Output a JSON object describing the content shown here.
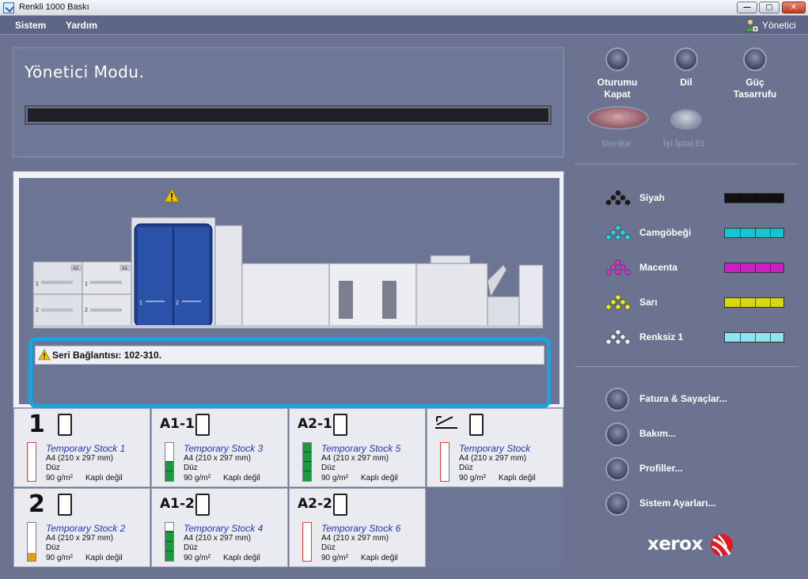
{
  "window": {
    "title": "Renkli 1000 Baskı",
    "min_glyph": "—",
    "max_glyph": "▢",
    "close_glyph": "✕"
  },
  "menu": {
    "items": [
      "Sistem",
      "Yardım"
    ],
    "user_label": "Yönetici"
  },
  "status": {
    "mode_title": "Yönetici Modu.",
    "progress": 0
  },
  "top_buttons": [
    {
      "label": "Oturumu\nKapat"
    },
    {
      "label": "Dil"
    },
    {
      "label": "Güç\nTasarrufu"
    }
  ],
  "job_buttons": {
    "stop_label": "Durdur",
    "cancel_label": "İşi İptal Et"
  },
  "machine": {
    "module_labels": [
      "A2",
      "A1"
    ],
    "tray_markers": [
      "1",
      "2",
      "1",
      "2",
      "1",
      "2"
    ]
  },
  "message": {
    "text": "Seri Bağlantısı: 102-310."
  },
  "trays": [
    {
      "id": "1",
      "name": "Temporary Stock 1",
      "size": "A4 (210 x 297 mm)",
      "type": "Düz",
      "weight": "90 g/m²",
      "coating": "Kaplı değil",
      "level": 0,
      "level_color": "#e34040"
    },
    {
      "id": "A1-1",
      "name": "Temporary Stock 3",
      "size": "A4 (210 x 297 mm)",
      "type": "Düz",
      "weight": "90 g/m²",
      "coating": "Kaplı değil",
      "level": 0.5,
      "level_color": "#1d9a3e"
    },
    {
      "id": "A2-1",
      "name": "Temporary Stock 5",
      "size": "A4 (210 x 297 mm)",
      "type": "Düz",
      "weight": "90 g/m²",
      "coating": "Kaplı değil",
      "level": 1.0,
      "level_color": "#1d9a3e"
    },
    {
      "id": "bypass",
      "name": "Temporary Stock",
      "size": "A4 (210 x 297 mm)",
      "type": "Düz",
      "weight": "90 g/m²",
      "coating": "Kaplı değil",
      "level": 0,
      "level_color": "#e34040"
    },
    {
      "id": "2",
      "name": "Temporary Stock 2",
      "size": "A4 (210 x 297 mm)",
      "type": "Düz",
      "weight": "90 g/m²",
      "coating": "Kaplı değil",
      "level": 0.2,
      "level_color": "#e0a010"
    },
    {
      "id": "A1-2",
      "name": "Temporary Stock 4",
      "size": "A4 (210 x 297 mm)",
      "type": "Düz",
      "weight": "90 g/m²",
      "coating": "Kaplı değil",
      "level": 0.8,
      "level_color": "#1d9a3e"
    },
    {
      "id": "A2-2",
      "name": "Temporary Stock 6",
      "size": "A4 (210 x 297 mm)",
      "type": "Düz",
      "weight": "90 g/m²",
      "coating": "Kaplı değil",
      "level": 0,
      "level_color": "#e34040"
    }
  ],
  "toners": [
    {
      "name": "Siyah",
      "color": "#111111",
      "dot_color": "#1a1a1a",
      "level": 1.0
    },
    {
      "name": "Camgöbeği",
      "color": "#18c4cf",
      "dot_color": "#22d6e6",
      "level": 1.0
    },
    {
      "name": "Macenta",
      "color": "#cc1fc4",
      "dot_color": "#e22ad8",
      "level": 1.0
    },
    {
      "name": "Sarı",
      "color": "#d9d810",
      "dot_color": "#ecec18",
      "level": 1.0
    },
    {
      "name": "Renksiz 1",
      "color": "#8fe4f0",
      "dot_color": "#e6f2f6",
      "level": 1.0
    }
  ],
  "menu_buttons": [
    {
      "label": "Fatura & Sayaçlar..."
    },
    {
      "label": "Bakım..."
    },
    {
      "label": "Profiller..."
    },
    {
      "label": "Sistem Ayarları..."
    }
  ],
  "brand": {
    "name": "xerox"
  }
}
